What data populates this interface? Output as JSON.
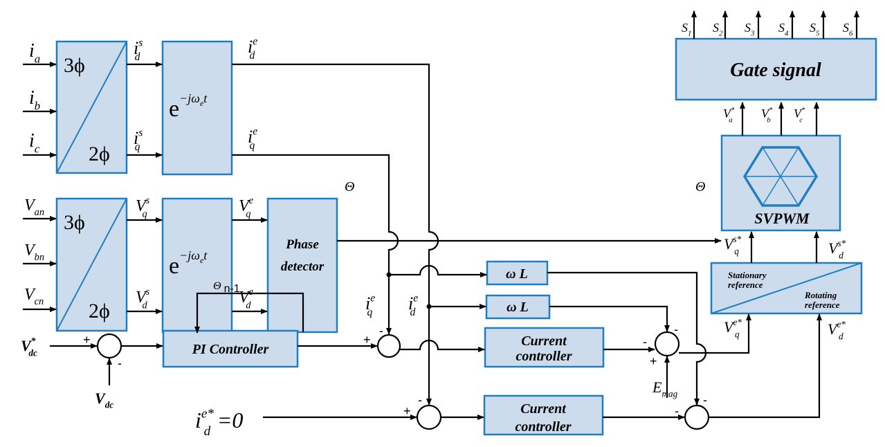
{
  "blocks": {
    "abc_to_dq_current": {
      "top": "3ϕ",
      "bottom": "2ϕ"
    },
    "rotation_current": {
      "base": "e",
      "exp": "−jω",
      "exp_sub": "e",
      "exp_t": "t"
    },
    "abc_to_dq_voltage": {
      "top": "3ϕ",
      "bottom": "2ϕ"
    },
    "rotation_voltage": {
      "base": "e",
      "exp": "−jω",
      "exp_sub": "e",
      "exp_t": "t"
    },
    "phase_detector": {
      "line1": "Phase",
      "line2": "detector"
    },
    "pi_controller": "PI Controller",
    "current_controller_q": {
      "line1": "Current",
      "line2": "controller"
    },
    "current_controller_d": {
      "line1": "Current",
      "line2": "controller"
    },
    "omega_l_1": {
      "w": "ω",
      "l": "L"
    },
    "omega_l_2": {
      "w": "ω",
      "l": "L"
    },
    "frame_transform": {
      "top1": "Stationary",
      "top2": "reference",
      "bot1": "Rotating",
      "bot2": "reference"
    },
    "svpwm": "SVPWM",
    "gate_signal": "Gate signal"
  },
  "labels": {
    "ia": {
      "b": "i",
      "s": "a"
    },
    "ib": {
      "b": "i",
      "s": "b"
    },
    "ic": {
      "b": "i",
      "s": "c"
    },
    "ids": {
      "b": "i",
      "s": "d",
      "p": "s"
    },
    "iqs": {
      "b": "i",
      "s": "q",
      "p": "s"
    },
    "ide": {
      "b": "i",
      "s": "d",
      "p": "e"
    },
    "iqe": {
      "b": "i",
      "s": "q",
      "p": "e"
    },
    "van": {
      "b": "V",
      "s": "an"
    },
    "vbn": {
      "b": "V",
      "s": "bn"
    },
    "vcn": {
      "b": "V",
      "s": "cn"
    },
    "vqs": {
      "b": "V",
      "s": "q",
      "p": "s"
    },
    "vds": {
      "b": "V",
      "s": "d",
      "p": "s"
    },
    "vqe": {
      "b": "V",
      "s": "q",
      "p": "e"
    },
    "vde": {
      "b": "V",
      "s": "d",
      "p": "e"
    },
    "theta": "Θ",
    "theta2": "Θ",
    "theta_prev": {
      "b": "Θ",
      "s": "n-1"
    },
    "iqe_v": {
      "b": "i",
      "s": "q",
      "p": "e"
    },
    "ide_v": {
      "b": "i",
      "s": "d",
      "p": "e"
    },
    "vdc_ref": {
      "b": "V",
      "s": "dc",
      "p": "*"
    },
    "vdc": {
      "b": "V",
      "s": "dc"
    },
    "id_ref": {
      "b": "i",
      "s": "d",
      "p": "e*",
      "eq": "=0"
    },
    "emag": {
      "b": "E",
      "s": "mag"
    },
    "vqe_ref": {
      "b": "V",
      "s": "q",
      "p": "e*"
    },
    "vde_ref": {
      "b": "V",
      "s": "d",
      "p": "e*"
    },
    "vqs_ref": {
      "b": "V",
      "s": "q",
      "p": "s*"
    },
    "vds_ref": {
      "b": "V",
      "s": "d",
      "p": "s*"
    },
    "va_ref": {
      "b": "V",
      "s": "a",
      "p": "*"
    },
    "vb_ref": {
      "b": "V",
      "s": "b",
      "p": "*"
    },
    "vc_ref": {
      "b": "V",
      "s": "c",
      "p": "*"
    },
    "switches": [
      {
        "b": "S",
        "s": "1"
      },
      {
        "b": "S",
        "s": "2"
      },
      {
        "b": "S",
        "s": "3"
      },
      {
        "b": "S",
        "s": "4"
      },
      {
        "b": "S",
        "s": "5"
      },
      {
        "b": "S",
        "s": "6"
      }
    ]
  },
  "signs": {
    "plus": "+",
    "minus": "-"
  },
  "colors": {
    "block_fill": "#cddcec",
    "block_stroke": "#1f7dc1",
    "line": "#000000"
  }
}
